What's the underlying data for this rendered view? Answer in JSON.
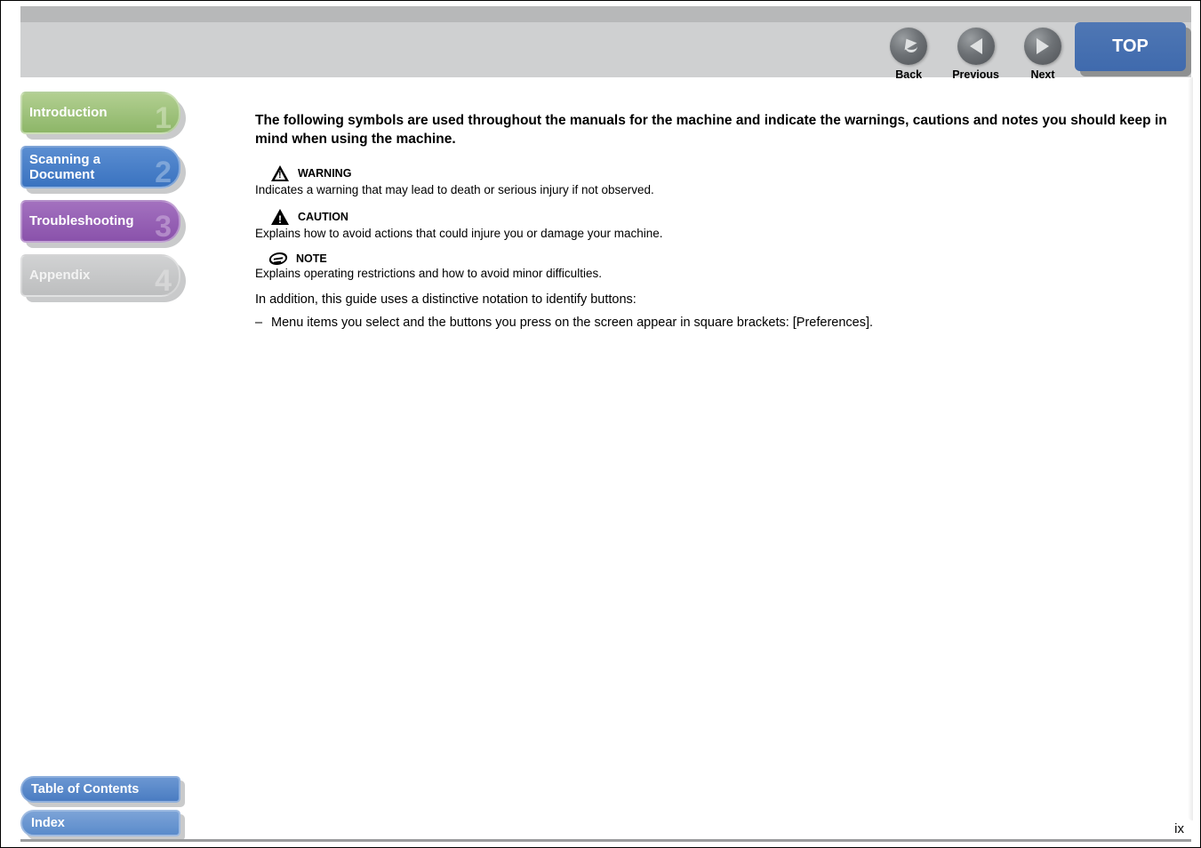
{
  "nav": {
    "back_label": "Back",
    "previous_label": "Previous",
    "next_label": "Next",
    "top_label": "TOP"
  },
  "sidebar": {
    "items": [
      {
        "label": "Introduction",
        "num": "1"
      },
      {
        "label": "Scanning a Document",
        "num": "2"
      },
      {
        "label": "Troubleshooting",
        "num": "3"
      },
      {
        "label": "Appendix",
        "num": "4"
      }
    ]
  },
  "bottom": {
    "toc_label": "Table of Contents",
    "index_label": "Index"
  },
  "content": {
    "lead": "The following symbols are used throughout the manuals for the machine and indicate the warnings, cautions and notes you should keep in mind when using the machine.",
    "warning_label": "WARNING",
    "warning_desc": "Indicates a warning that may lead to death or serious injury if not observed.",
    "caution_label": "CAUTION",
    "caution_desc": "Explains how to avoid actions that could injure you or damage your machine.",
    "note_label": "NOTE",
    "note_desc": "Explains operating restrictions and how to avoid minor difficulties.",
    "additional": "In addition, this guide uses a distinctive notation to identify buttons:",
    "bullet1": "Menu items you select and the buttons you press on the screen appear in square brackets: [Preferences]."
  },
  "page_number": "ix"
}
